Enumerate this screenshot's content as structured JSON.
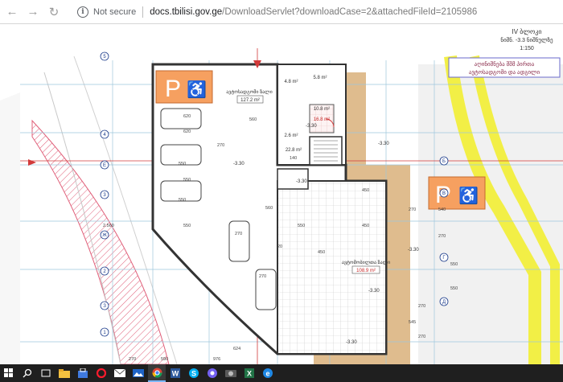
{
  "browser": {
    "back_label": "←",
    "forward_label": "→",
    "reload_label": "↻",
    "security_label": "Not secure",
    "url_host": "docs.tbilisi.gov.ge",
    "url_path": "/DownloadServlet?downloadCase=2&attachedFileId=2105986"
  },
  "drawing": {
    "stamp_line1": "IV  ბლოკი",
    "stamp_line2": "ნიშნ. -3.3  ნიშნულზე",
    "stamp_line3": "1:150",
    "legend_line1": "აღინიშნება შშმ პირთა",
    "legend_line2": "ავტოსადგომი და  ადგილი",
    "room_parking_label": "ავტოსადგომი ზალი",
    "room_parking_area": "127.2 m²",
    "room_small1_area": "5.8 m²",
    "room_small2_area": "4.8 m²",
    "room_red_area": "16.8 m²",
    "room_small3_area": "10.8 m²",
    "room_stair_area": "22.8 m²",
    "room_mid_area": "2.6 m²",
    "room_main_label": "ავტომობილთა ზალი",
    "room_main_area": "108.9 m²",
    "level_marks": [
      "-3.30",
      "-3.30",
      "-3.30",
      "-3.30",
      "-3.30",
      "-3.30",
      "-3.30"
    ],
    "dims": [
      "550",
      "270",
      "450",
      "450",
      "550",
      "270",
      "270",
      "560",
      "550",
      "550",
      "560",
      "550",
      "620",
      "624",
      "976",
      "590",
      "270",
      "2.560",
      "270",
      "545",
      "270",
      "540",
      "450",
      "20",
      "140",
      "270",
      "550",
      "620",
      "550",
      "270"
    ],
    "grid_labels": [
      "5",
      "4",
      "3",
      "2",
      "1",
      "Б",
      "В",
      "Г",
      "Д",
      "Е",
      "Ж",
      "З"
    ]
  },
  "taskbar": {
    "apps": [
      "windows-start",
      "search",
      "task-view",
      "file-explorer",
      "store",
      "opera",
      "mail",
      "photos",
      "chrome",
      "word",
      "skype",
      "viber",
      "camera",
      "excel",
      "edge"
    ]
  },
  "colors": {
    "yellow_path": "#f2ef46",
    "orange_room": "#f6a060",
    "brown_band": "#d9b07a",
    "grid_blue": "#9ec6dc",
    "red_hatch": "#e0607a",
    "taskbar": "#1f1f1f"
  }
}
